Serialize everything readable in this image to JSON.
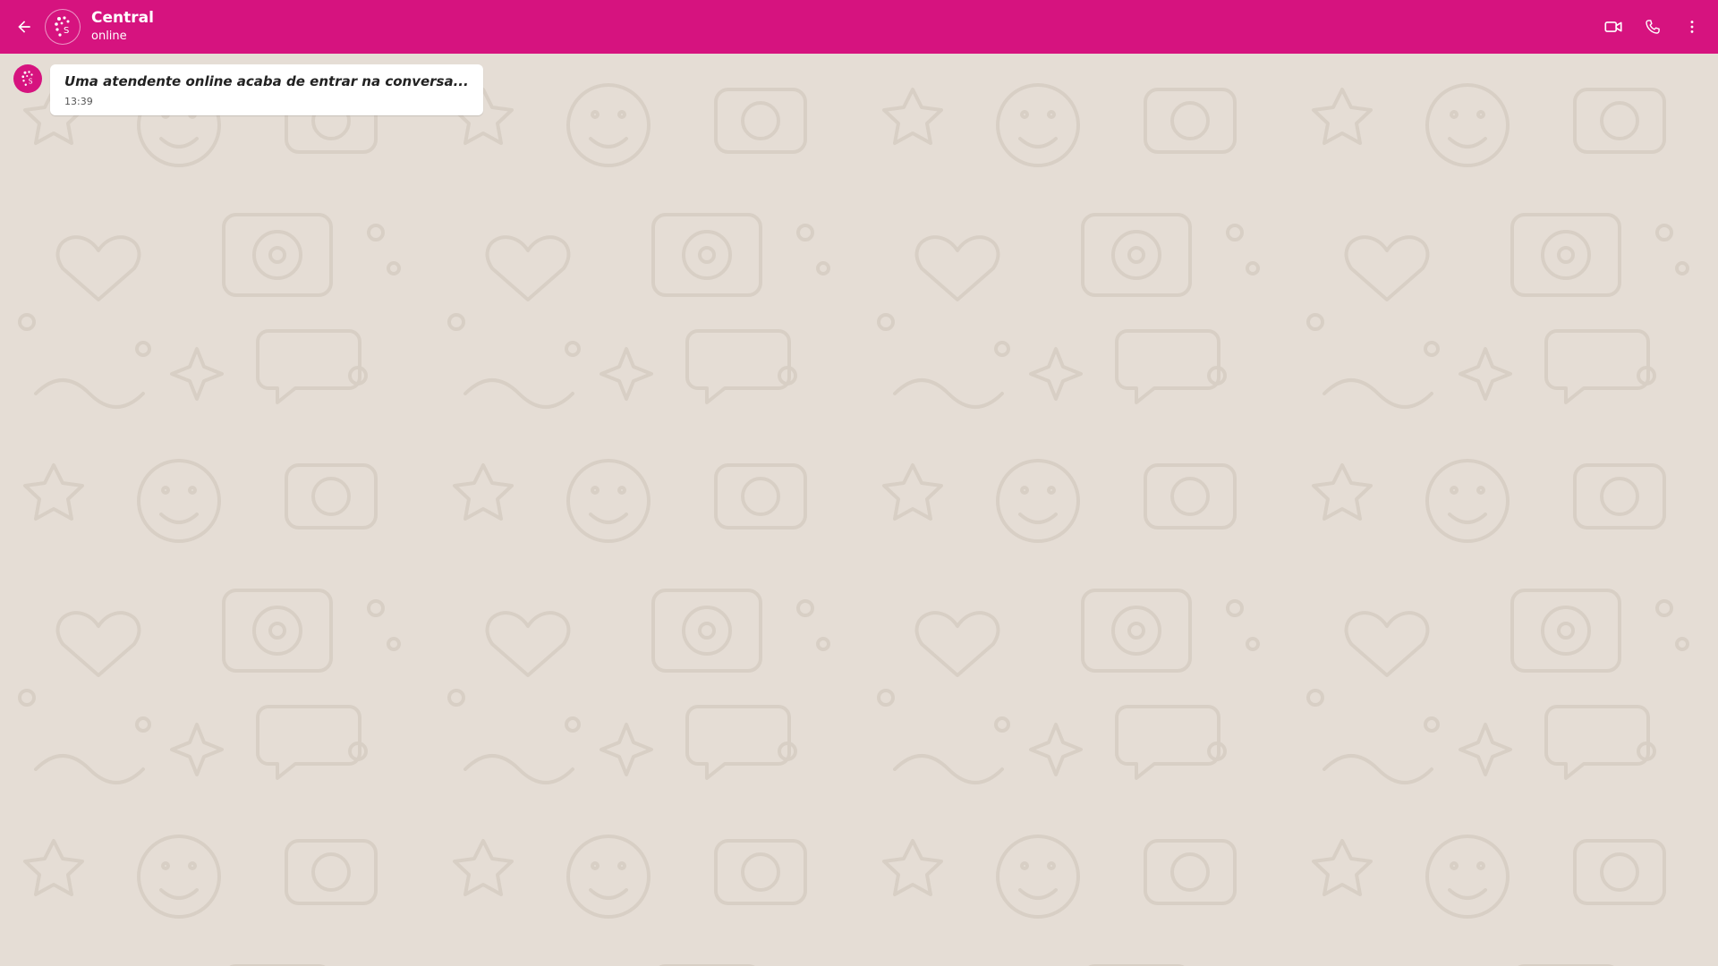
{
  "header": {
    "back_icon": "arrow-left-icon",
    "contact_name": "Central",
    "contact_status": "online",
    "avatar_icon": "dots-logo-icon",
    "actions": [
      "video-camera-icon",
      "phone-icon",
      "more-vertical-icon"
    ]
  },
  "messages": [
    {
      "sender_avatar_icon": "dots-logo-icon",
      "text": "Uma atendente online acaba de entrar na conversa...",
      "time": "13:39"
    }
  ],
  "colors": {
    "header_bg": "#d6137f",
    "chat_bg": "#e5ddd5",
    "bubble_bg": "#ffffff",
    "doodle": "#d6cdc3"
  }
}
